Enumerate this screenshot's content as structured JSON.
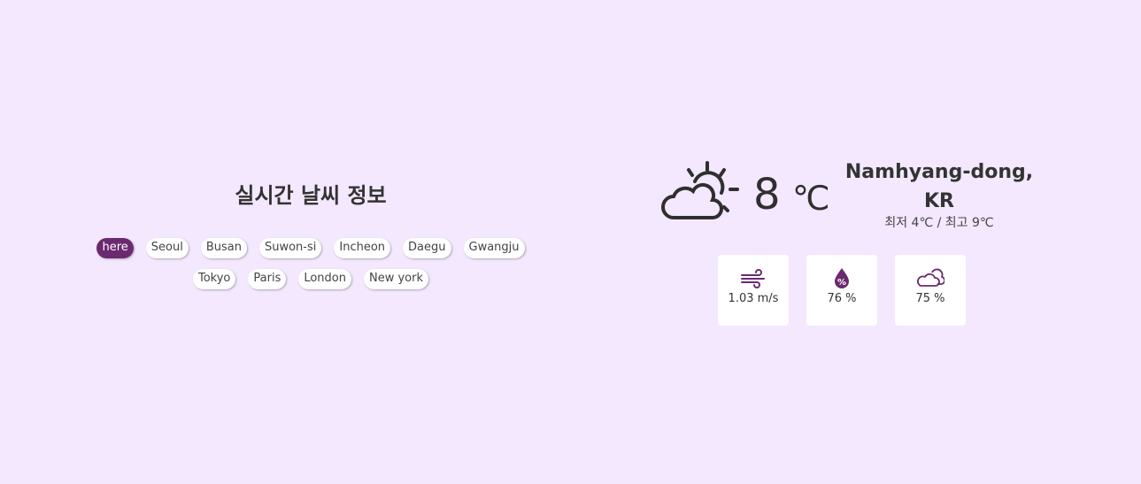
{
  "left": {
    "title": "실시간 날씨 정보",
    "cities": [
      "here",
      "Seoul",
      "Busan",
      "Suwon-si",
      "Incheon",
      "Daegu",
      "Gwangju",
      "Tokyo",
      "Paris",
      "London",
      "New york"
    ],
    "active_city": "here"
  },
  "weather": {
    "icon": "partly-cloudy-sun-icon",
    "temp": "8",
    "unit": "℃",
    "location": "Namhyang-dong, KR",
    "minmax": "최저 4℃ / 최고 9℃"
  },
  "stats": [
    {
      "icon": "wind-icon",
      "value": "1.03 m/s"
    },
    {
      "icon": "humidity-icon",
      "value": "76 %"
    },
    {
      "icon": "cloud-icon",
      "value": "75 %"
    }
  ],
  "colors": {
    "background": "#f3e8fd",
    "accent": "#6b2a6f",
    "card": "#ffffff"
  }
}
